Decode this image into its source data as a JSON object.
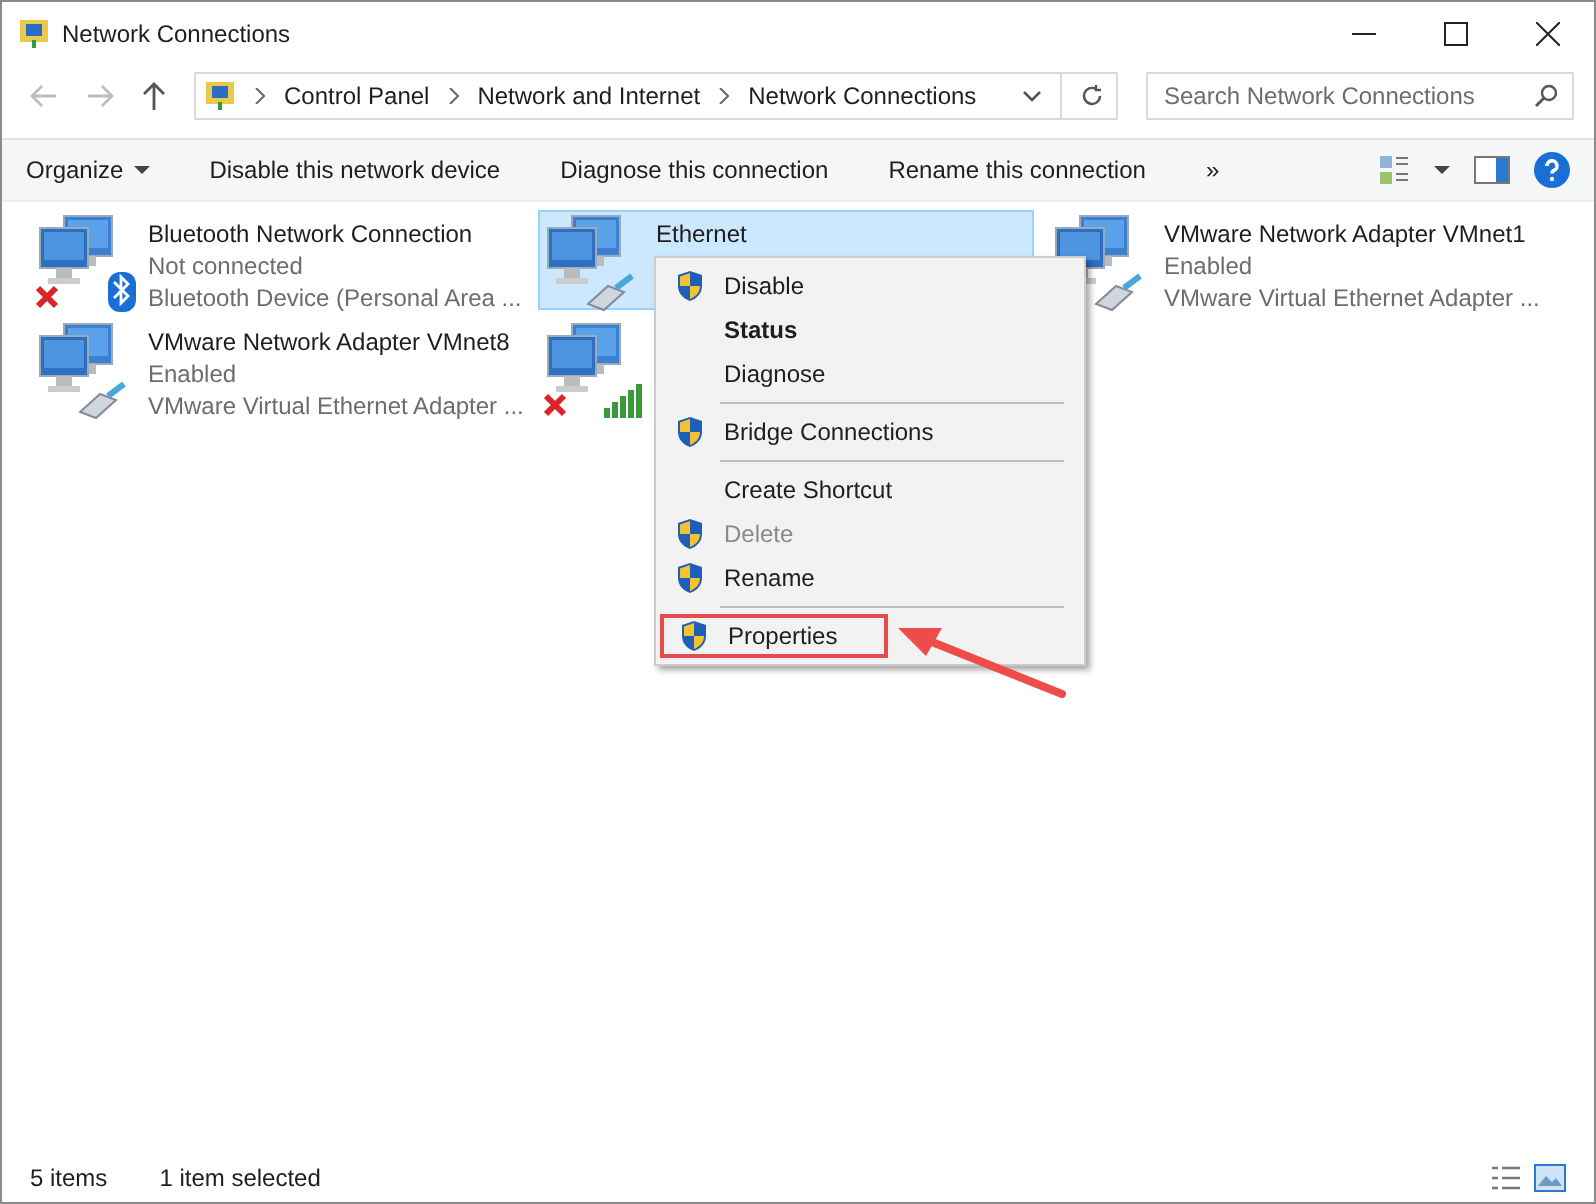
{
  "window": {
    "title": "Network Connections"
  },
  "address_bar": {
    "path": [
      "Control Panel",
      "Network and Internet",
      "Network Connections"
    ]
  },
  "search": {
    "placeholder": "Search Network Connections"
  },
  "toolbar": {
    "items": [
      {
        "label": "Organize",
        "dropdown": true
      },
      {
        "label": "Disable this network device",
        "dropdown": false
      },
      {
        "label": "Diagnose this connection",
        "dropdown": false
      },
      {
        "label": "Rename this connection",
        "dropdown": false
      },
      {
        "label": "»",
        "dropdown": false
      }
    ]
  },
  "connections": [
    {
      "name": "Bluetooth Network Connection",
      "status": "Not connected",
      "device": "Bluetooth Device (Personal Area ...",
      "kind": "bluetooth",
      "disconnected": true,
      "selected": false
    },
    {
      "name": "Ethernet",
      "kind": "cable",
      "disconnected": false,
      "selected": true
    },
    {
      "name": "VMware Network Adapter VMnet1",
      "status": "Enabled",
      "device": "VMware Virtual Ethernet Adapter ...",
      "kind": "cable",
      "disconnected": false,
      "selected": false
    },
    {
      "name": "VMware Network Adapter VMnet8",
      "status": "Enabled",
      "device": "VMware Virtual Ethernet Adapter ...",
      "kind": "cable",
      "disconnected": false,
      "selected": false
    },
    {
      "kind": "signal",
      "disconnected": true,
      "selected": false
    }
  ],
  "context_menu": {
    "items": [
      {
        "kind": "item",
        "label": "Disable",
        "shield": true,
        "bold": false,
        "disabled": false,
        "highlighted": false
      },
      {
        "kind": "item",
        "label": "Status",
        "shield": false,
        "bold": true,
        "disabled": false,
        "highlighted": false
      },
      {
        "kind": "item",
        "label": "Diagnose",
        "shield": false,
        "bold": false,
        "disabled": false,
        "highlighted": false
      },
      {
        "kind": "separator"
      },
      {
        "kind": "item",
        "label": "Bridge Connections",
        "shield": true,
        "bold": false,
        "disabled": false,
        "highlighted": false
      },
      {
        "kind": "separator"
      },
      {
        "kind": "item",
        "label": "Create Shortcut",
        "shield": false,
        "bold": false,
        "disabled": false,
        "highlighted": false
      },
      {
        "kind": "item",
        "label": "Delete",
        "shield": true,
        "bold": false,
        "disabled": true,
        "highlighted": false
      },
      {
        "kind": "item",
        "label": "Rename",
        "shield": true,
        "bold": false,
        "disabled": false,
        "highlighted": false
      },
      {
        "kind": "separator"
      },
      {
        "kind": "item",
        "label": "Properties",
        "shield": true,
        "bold": false,
        "disabled": false,
        "highlighted": true
      }
    ]
  },
  "status_bar": {
    "items": [
      "5 items",
      "1 item selected"
    ]
  }
}
